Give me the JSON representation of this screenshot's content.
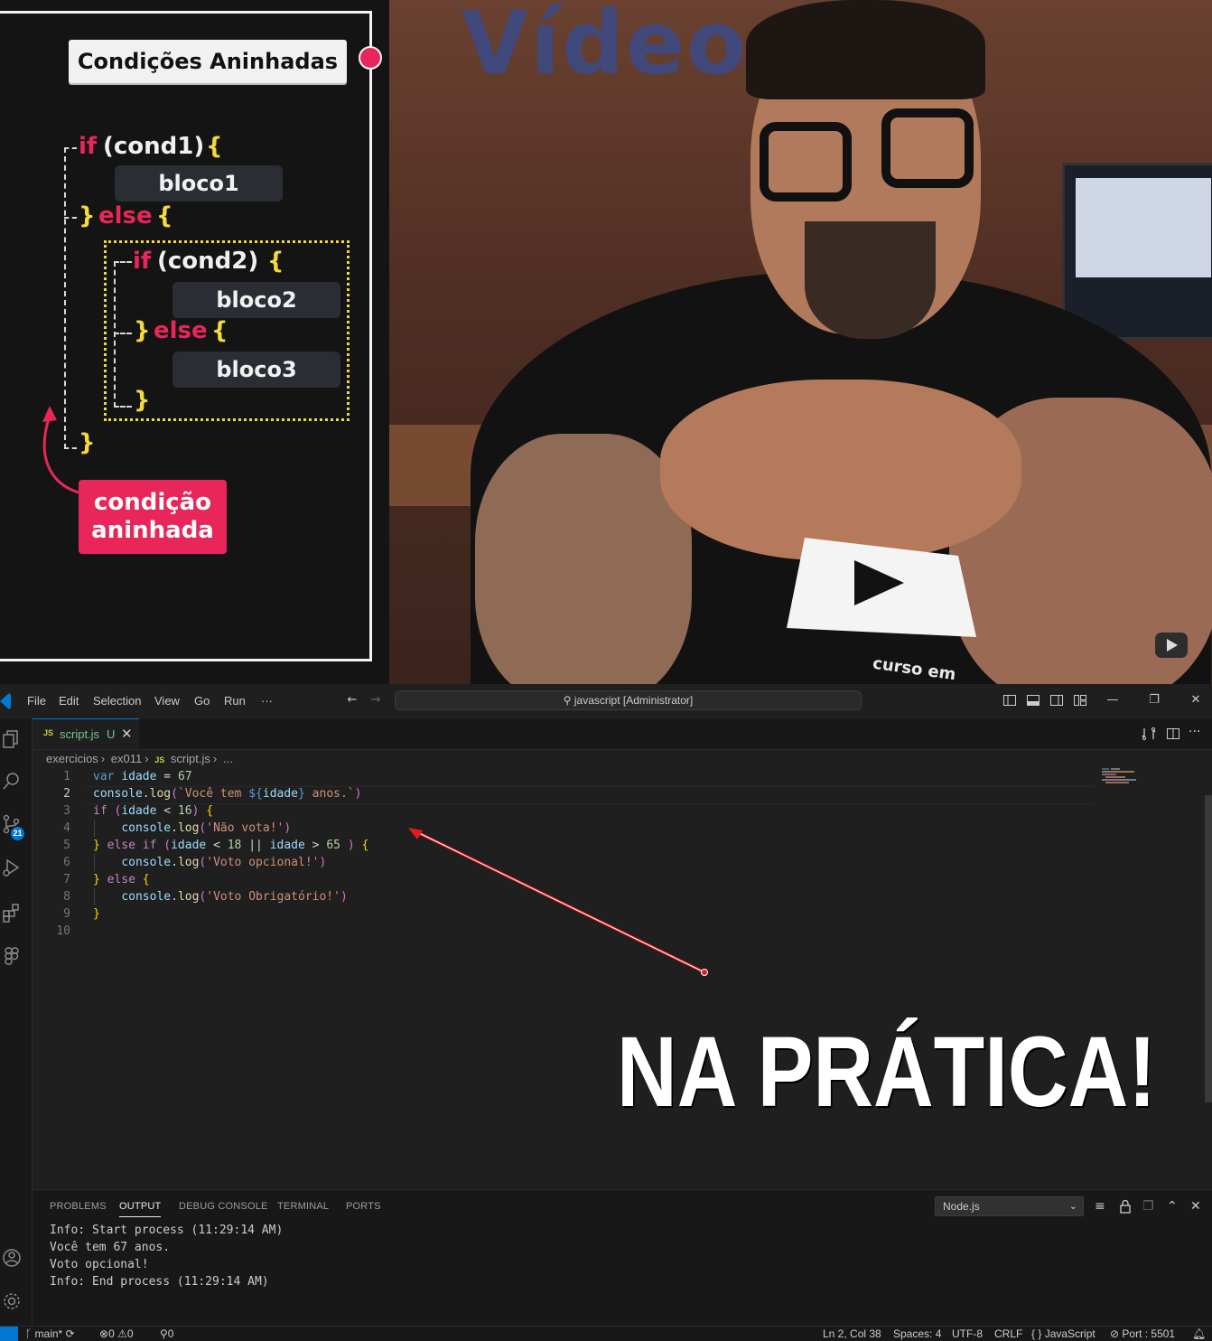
{
  "slide": {
    "title": "Condições Aninhadas",
    "if1": "if",
    "cond1": "(cond1)",
    "brace_open": "{",
    "bloco1": "bloco1",
    "close_else": "}",
    "else1": "else",
    "if2": "if",
    "cond2": "(cond2)",
    "bloco2": "bloco2",
    "else2": "else",
    "bloco3": "bloco3",
    "brace_close": "}",
    "badge_line1": "condição",
    "badge_line2": "aninhada",
    "accent_color": "#e8265a",
    "highlight_color": "#f4d93a"
  },
  "video": {
    "wall_text": "Vídeo",
    "shirt_text": "curso em"
  },
  "titlebar": {
    "menu": [
      "File",
      "Edit",
      "Selection",
      "View",
      "Go",
      "Run",
      "···"
    ],
    "search": "javascript [Administrator]"
  },
  "activity": {
    "scm_count": "21"
  },
  "tab": {
    "icon_text": "JS",
    "name": "script.js",
    "status": "U"
  },
  "breadcrumb": {
    "items": [
      "exercicios",
      "ex011",
      "JS",
      "script.js",
      "..."
    ]
  },
  "editor": {
    "line_numbers": [
      "1",
      "2",
      "3",
      "4",
      "5",
      "6",
      "7",
      "8",
      "9",
      "10"
    ],
    "active_line": "2",
    "code": [
      "var idade = 67",
      "console.log(`Você tem ${idade} anos.`)",
      "if (idade < 16) {",
      "    console.log('Não vota!')",
      "} else if (idade < 18 || idade > 65 ) {",
      "    console.log('Voto opcional!')",
      "} else {",
      "    console.log('Voto Obrigatório!')",
      "}",
      ""
    ]
  },
  "overlay": {
    "caption": "NA PRÁTICA!"
  },
  "panel": {
    "tabs": [
      "PROBLEMS",
      "OUTPUT",
      "DEBUG CONSOLE",
      "TERMINAL",
      "PORTS"
    ],
    "active_tab": "OUTPUT",
    "channel": "Node.js",
    "output": [
      "Info: Start process (11:29:14 AM)",
      "Você tem 67 anos.",
      "Voto opcional!",
      "Info: End process (11:29:14 AM)"
    ]
  },
  "statusbar": {
    "branch": "main*",
    "errors": "0",
    "warnings": "0",
    "ports": "0",
    "position": "Ln 2, Col 38",
    "spaces": "Spaces: 4",
    "encoding": "UTF-8",
    "eol": "CRLF",
    "language": "JavaScript",
    "live_server": "Port : 5501"
  }
}
